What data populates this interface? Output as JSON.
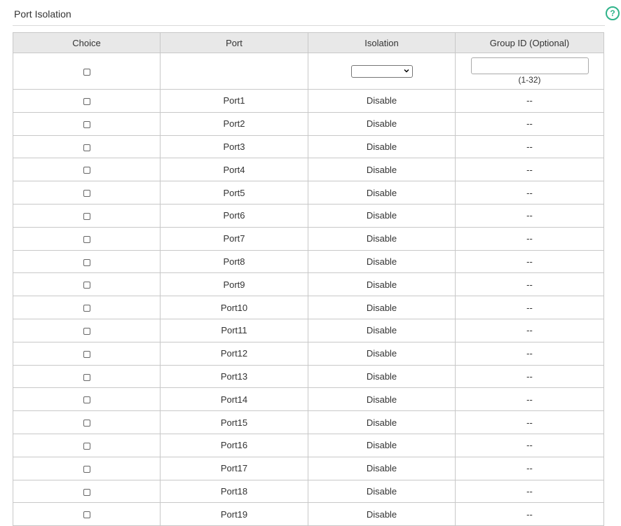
{
  "header": {
    "title": "Port Isolation",
    "help_symbol": "?"
  },
  "table": {
    "columns": [
      "Choice",
      "Port",
      "Isolation",
      "Group ID (Optional)"
    ],
    "filter": {
      "isolation_selected": "",
      "group_id_value": "",
      "group_id_range": "(1-32)"
    },
    "rows": [
      {
        "port": "Port1",
        "isolation": "Disable",
        "group_id": "--"
      },
      {
        "port": "Port2",
        "isolation": "Disable",
        "group_id": "--"
      },
      {
        "port": "Port3",
        "isolation": "Disable",
        "group_id": "--"
      },
      {
        "port": "Port4",
        "isolation": "Disable",
        "group_id": "--"
      },
      {
        "port": "Port5",
        "isolation": "Disable",
        "group_id": "--"
      },
      {
        "port": "Port6",
        "isolation": "Disable",
        "group_id": "--"
      },
      {
        "port": "Port7",
        "isolation": "Disable",
        "group_id": "--"
      },
      {
        "port": "Port8",
        "isolation": "Disable",
        "group_id": "--"
      },
      {
        "port": "Port9",
        "isolation": "Disable",
        "group_id": "--"
      },
      {
        "port": "Port10",
        "isolation": "Disable",
        "group_id": "--"
      },
      {
        "port": "Port11",
        "isolation": "Disable",
        "group_id": "--"
      },
      {
        "port": "Port12",
        "isolation": "Disable",
        "group_id": "--"
      },
      {
        "port": "Port13",
        "isolation": "Disable",
        "group_id": "--"
      },
      {
        "port": "Port14",
        "isolation": "Disable",
        "group_id": "--"
      },
      {
        "port": "Port15",
        "isolation": "Disable",
        "group_id": "--"
      },
      {
        "port": "Port16",
        "isolation": "Disable",
        "group_id": "--"
      },
      {
        "port": "Port17",
        "isolation": "Disable",
        "group_id": "--"
      },
      {
        "port": "Port18",
        "isolation": "Disable",
        "group_id": "--"
      },
      {
        "port": "Port19",
        "isolation": "Disable",
        "group_id": "--"
      }
    ]
  },
  "colors": {
    "accent": "#2fb38a",
    "header_bg": "#e8e8e8",
    "border": "#c8c8c8"
  }
}
